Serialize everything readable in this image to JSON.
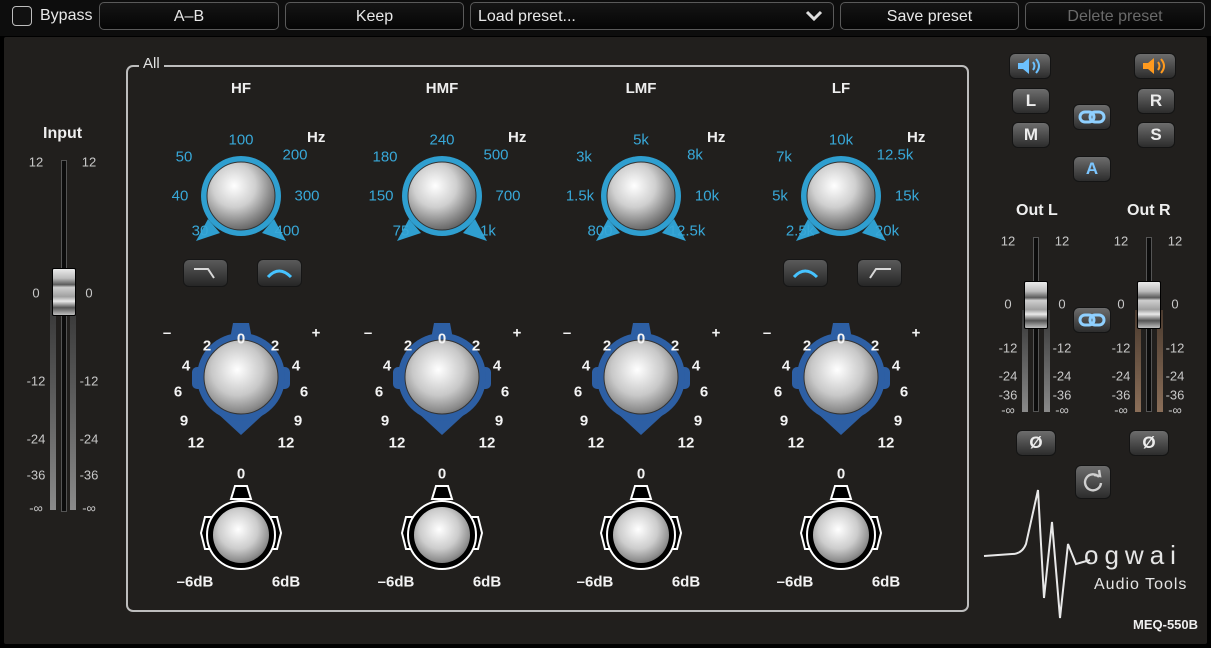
{
  "toolbar": {
    "bypass_label": "Bypass",
    "ab_label": "A–B",
    "keep_label": "Keep",
    "preset_value": "Load preset...",
    "save_label": "Save preset",
    "delete_label": "Delete preset"
  },
  "input": {
    "label": "Input",
    "scale": [
      "12",
      "0",
      "-12",
      "-24",
      "-36",
      "-∞"
    ]
  },
  "all_label": "All",
  "bands": [
    {
      "name": "HF",
      "freq_unit": "Hz",
      "freq_labels": [
        "30",
        "40",
        "50",
        "100",
        "200",
        "300",
        "400"
      ],
      "shape_buttons": [
        "shelf-icon",
        "bell-icon"
      ],
      "gain_labels": [
        "12",
        "9",
        "6",
        "4",
        "2",
        "0",
        "2",
        "4",
        "6",
        "9",
        "12"
      ],
      "trim_zero": "0",
      "trim_min": "–6dB",
      "trim_max": "6dB"
    },
    {
      "name": "HMF",
      "freq_unit": "Hz",
      "freq_labels": [
        "75",
        "150",
        "180",
        "240",
        "500",
        "700",
        "1k"
      ],
      "shape_buttons": [],
      "gain_labels": [
        "12",
        "9",
        "6",
        "4",
        "2",
        "0",
        "2",
        "4",
        "6",
        "9",
        "12"
      ],
      "trim_zero": "0",
      "trim_min": "–6dB",
      "trim_max": "6dB"
    },
    {
      "name": "LMF",
      "freq_unit": "Hz",
      "freq_labels": [
        "800",
        "1.5k",
        "3k",
        "5k",
        "8k",
        "10k",
        "12.5k"
      ],
      "shape_buttons": [],
      "gain_labels": [
        "12",
        "9",
        "6",
        "4",
        "2",
        "0",
        "2",
        "4",
        "6",
        "9",
        "12"
      ],
      "trim_zero": "0",
      "trim_min": "–6dB",
      "trim_max": "6dB"
    },
    {
      "name": "LF",
      "freq_unit": "Hz",
      "freq_labels": [
        "2.5k",
        "5k",
        "7k",
        "10k",
        "12.5k",
        "15k",
        "20k"
      ],
      "shape_buttons": [
        "bell-icon",
        "shelf-icon"
      ],
      "gain_labels": [
        "12",
        "9",
        "6",
        "4",
        "2",
        "0",
        "2",
        "4",
        "6",
        "9",
        "12"
      ],
      "trim_zero": "0",
      "trim_min": "–6dB",
      "trim_max": "6dB"
    }
  ],
  "gain_minus": "–",
  "gain_plus": "+",
  "routing": {
    "left": "L",
    "right": "R",
    "mid": "M",
    "side": "S",
    "a": "A"
  },
  "outputs": {
    "left_label": "Out L",
    "right_label": "Out R",
    "scale": [
      "12",
      "0",
      "-12",
      "-24",
      "-36",
      "-∞"
    ],
    "phase_glyph": "Ø"
  },
  "brand": {
    "name": "ogwai",
    "subtitle": "Audio Tools",
    "model": "MEQ-550B"
  },
  "colors": {
    "freq_accent": "#2f9fd0",
    "gain_accent": "#2d5fa4",
    "speaker_left": "#6cc1ff",
    "speaker_right": "#ff9a1e"
  }
}
